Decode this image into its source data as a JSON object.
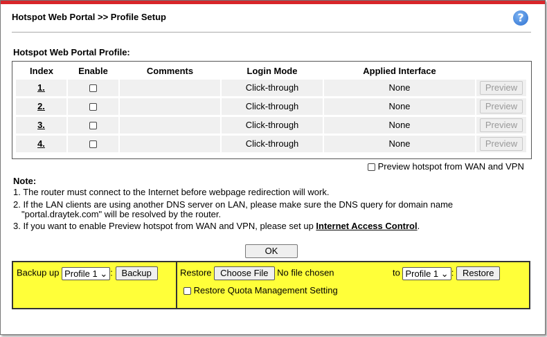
{
  "header": {
    "title": "Hotspot Web Portal >> Profile Setup",
    "help": "?"
  },
  "section": {
    "title": "Hotspot Web Portal Profile:"
  },
  "table": {
    "headers": [
      "Index",
      "Enable",
      "Comments",
      "Login Mode",
      "Applied Interface"
    ],
    "rows": [
      {
        "index": "1.",
        "comments": "",
        "login_mode": "Click-through",
        "interface": "None",
        "preview": "Preview"
      },
      {
        "index": "2.",
        "comments": "",
        "login_mode": "Click-through",
        "interface": "None",
        "preview": "Preview"
      },
      {
        "index": "3.",
        "comments": "",
        "login_mode": "Click-through",
        "interface": "None",
        "preview": "Preview"
      },
      {
        "index": "4.",
        "comments": "",
        "login_mode": "Click-through",
        "interface": "None",
        "preview": "Preview"
      }
    ]
  },
  "preview_wan": {
    "label": "Preview hotspot from WAN and VPN"
  },
  "notes": {
    "title": "Note:",
    "line1": "1. The router must connect to the Internet before webpage redirection will work.",
    "line2a": "2. If the LAN clients are using another DNS server on LAN, please make sure the DNS query for domain name",
    "line2b": "\"portal.draytek.com\" will be resolved by the router.",
    "line3a": "3. If you want to enable Preview hotspot from WAN and VPN, please set up ",
    "line3_link": "Internet Access Control",
    "line3b": "."
  },
  "ok_label": "OK",
  "backup": {
    "label": "Backup up",
    "select": "Profile 1",
    "button": "Backup"
  },
  "restore": {
    "label": "Restore",
    "choose_file": "Choose File",
    "file_status": "No file chosen",
    "to_label": "to",
    "select": "Profile 1",
    "button": "Restore",
    "quota_label": "Restore Quota Management Setting"
  }
}
